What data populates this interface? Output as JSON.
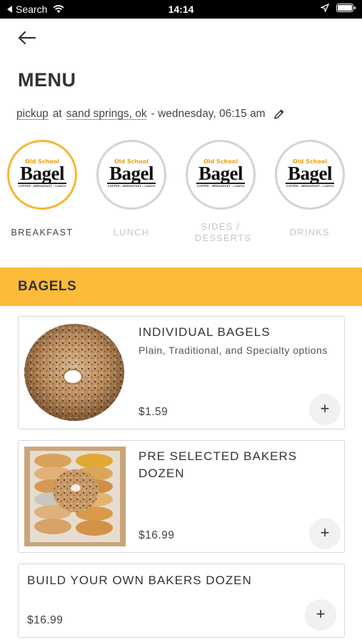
{
  "status_bar": {
    "back_label": "Search",
    "time": "14:14"
  },
  "header": {
    "title": "MENU"
  },
  "order": {
    "mode": "pickup",
    "at": "at",
    "location": "sand springs, ok",
    "time_text": "- wednesday, 06:15 am"
  },
  "categories": [
    {
      "label": "BREAKFAST",
      "active": true
    },
    {
      "label": "LUNCH",
      "active": false
    },
    {
      "label": "SIDES / DESSERTS",
      "active": false
    },
    {
      "label": "DRINKS",
      "active": false
    }
  ],
  "logo": {
    "line1": "Old School",
    "line2": "Bagel",
    "tagline": "COFFEE • BREAKFAST • LUNCH"
  },
  "section": {
    "title": "BAGELS"
  },
  "items": [
    {
      "title": "INDIVIDUAL BAGELS",
      "description": "Plain, Traditional, and Specialty options",
      "price": "$1.59"
    },
    {
      "title": "PRE SELECTED BAKERS DOZEN",
      "description": "",
      "price": "$16.99"
    },
    {
      "title": "BUILD YOUR OWN BAKERS DOZEN",
      "description": "",
      "price": "$16.99"
    }
  ],
  "add_label": "+",
  "colors": {
    "accent": "#fdbb3a",
    "active_ring": "#f5b731",
    "logo_gold": "#e3a21a"
  }
}
